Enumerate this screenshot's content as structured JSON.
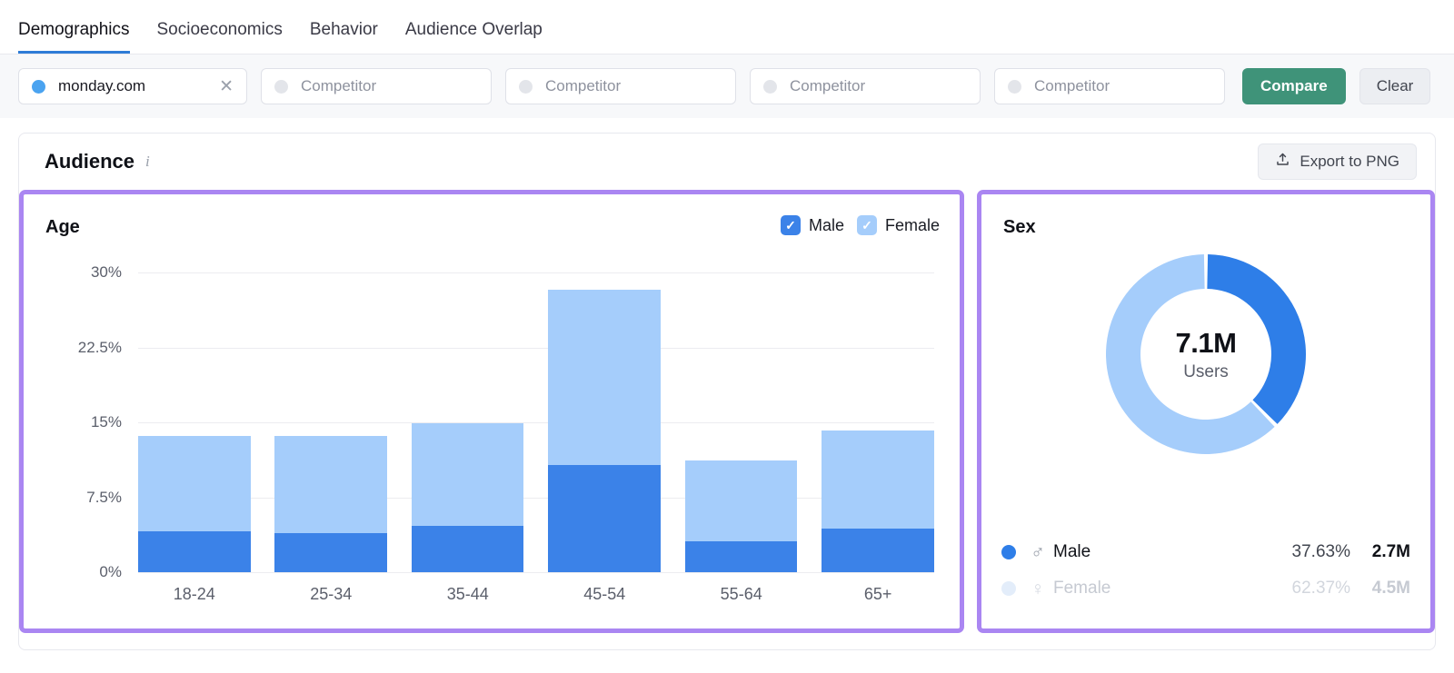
{
  "tabs": [
    {
      "label": "Demographics",
      "active": true
    },
    {
      "label": "Socioeconomics",
      "active": false
    },
    {
      "label": "Behavior",
      "active": false
    },
    {
      "label": "Audience Overlap",
      "active": false
    }
  ],
  "competitor_bar": {
    "domain_chip": {
      "value": "monday.com",
      "dot_color": "#4aa3f0",
      "clear_icon": "close-icon",
      "clear_glyph": "✕"
    },
    "competitor_placeholders": [
      "Competitor",
      "Competitor",
      "Competitor",
      "Competitor"
    ],
    "compare_label": "Compare",
    "clear_label": "Clear",
    "compare_color": "#3f9379"
  },
  "card": {
    "title": "Audience",
    "info_icon": "info-icon",
    "export_label": "Export to PNG",
    "export_icon": "upload-icon"
  },
  "age_panel": {
    "title": "Age",
    "legend": [
      {
        "label": "Male",
        "checked": true,
        "color": "#3b82e8"
      },
      {
        "label": "Female",
        "checked": true,
        "color": "#a5cdfb"
      }
    ]
  },
  "sex_panel": {
    "title": "Sex",
    "center_value": "7.1M",
    "center_label": "Users",
    "rows": [
      {
        "name": "Male",
        "symbol": "♂",
        "percent": "37.63%",
        "value": "2.7M",
        "color": "#2e7ee8",
        "dimmed": false
      },
      {
        "name": "Female",
        "symbol": "♀",
        "percent": "62.37%",
        "value": "4.5M",
        "color": "#e3edfa",
        "dimmed": true
      }
    ]
  },
  "chart_data": [
    {
      "type": "bar",
      "title": "Age",
      "stacked": true,
      "categories": [
        "18-24",
        "25-34",
        "35-44",
        "45-54",
        "55-64",
        "65+"
      ],
      "series": [
        {
          "name": "Male",
          "color": "#3b82e8",
          "values": [
            4.1,
            3.9,
            4.65,
            10.7,
            3.1,
            4.4
          ]
        },
        {
          "name": "Female",
          "color": "#a5cdfb",
          "values": [
            9.5,
            9.7,
            10.25,
            17.6,
            8.1,
            9.8
          ]
        }
      ],
      "totals": [
        13.6,
        13.6,
        14.9,
        28.3,
        11.2,
        14.2
      ],
      "xlabel": "",
      "ylabel": "",
      "ylim": [
        0,
        30
      ],
      "yticks": [
        "0%",
        "7.5%",
        "15%",
        "22.5%",
        "30%"
      ],
      "ytick_values": [
        0,
        7.5,
        15,
        22.5,
        30
      ],
      "grid": true,
      "legend_position": "top-right"
    },
    {
      "type": "pie",
      "title": "Sex",
      "donut": true,
      "center_value": "7.1M",
      "center_label": "Users",
      "labels": [
        "Male",
        "Female"
      ],
      "values": [
        37.63,
        62.37
      ],
      "absolute": [
        "2.7M",
        "4.5M"
      ],
      "colors": [
        "#2e7ee8",
        "#a5cdfb"
      ],
      "legend_position": "bottom"
    }
  ]
}
